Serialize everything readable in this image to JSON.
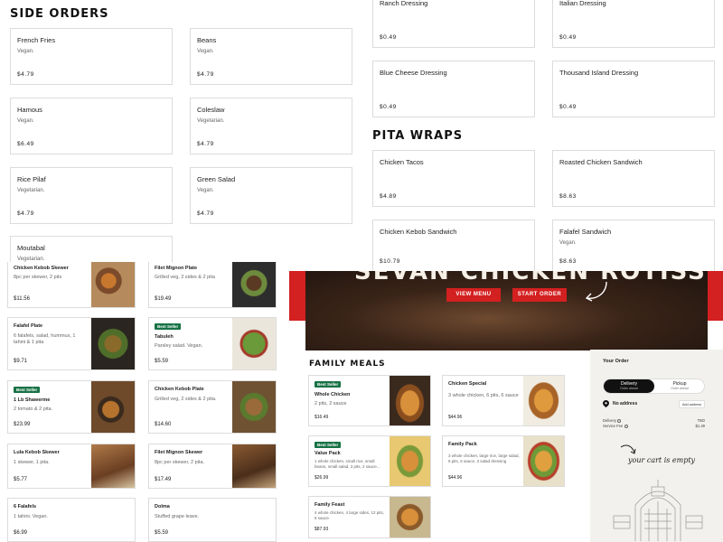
{
  "side_orders": {
    "title": "SIDE ORDERS",
    "items": [
      {
        "name": "French Fries",
        "desc": "Vegan.",
        "price": "$4.79"
      },
      {
        "name": "Beans",
        "desc": "Vegan.",
        "price": "$4.79"
      },
      {
        "name": "Hamous",
        "desc": "Vegan.",
        "price": "$6.49"
      },
      {
        "name": "Coleslaw",
        "desc": "Vegetarian.",
        "price": "$4.79"
      },
      {
        "name": "Rice Pilaf",
        "desc": "Vegetarian.",
        "price": "$4.79"
      },
      {
        "name": "Green Salad",
        "desc": "Vegan.",
        "price": "$4.79"
      },
      {
        "name": "Moutabal",
        "desc": "Vegetarian."
      }
    ]
  },
  "dressings": [
    {
      "name": "Ranch Dressing",
      "price": "$0.49"
    },
    {
      "name": "Italian Dressing",
      "price": "$0.49"
    },
    {
      "name": "Blue Cheese Dressing",
      "price": "$0.49"
    },
    {
      "name": "Thousand Island Dressing",
      "price": "$0.49"
    }
  ],
  "pita_wraps": {
    "title": "PITA WRAPS",
    "items": [
      {
        "name": "Chicken Tacos",
        "desc": "",
        "price": "$4.89"
      },
      {
        "name": "Roasted Chicken Sandwich",
        "desc": "",
        "price": "$8.63"
      },
      {
        "name": "Chicken Kebob Sandwich",
        "desc": "",
        "price": "$10.79"
      },
      {
        "name": "Falafel Sandwich",
        "desc": "Vegan.",
        "price": "$8.63"
      }
    ]
  },
  "plates": [
    {
      "name": "Chicken Kebob Skewer",
      "desc": "8pc per skewer, 2 pits",
      "price": "$11.56",
      "badge": ""
    },
    {
      "name": "Filet Mignon Plate",
      "desc": "Grilled veg, 2 sides & 2 pita",
      "price": "$19.49",
      "badge": ""
    },
    {
      "name": "Falafel Plate",
      "desc": "6 falafels, salad, hummus, 1 tahini & 1 pita",
      "price": "$9.71",
      "badge": ""
    },
    {
      "name": "Tabuleh",
      "desc": "Parsley salad. Vegan.",
      "price": "$5.59",
      "badge": "Best Seller"
    },
    {
      "name": "1 Lb Shawerme",
      "desc": "2 tomato & 2 pita.",
      "price": "$23.99",
      "badge": "Best Seller"
    },
    {
      "name": "Chicken Kebob Plate",
      "desc": "Grilled veg, 2 sides & 2 pita.",
      "price": "$14.60",
      "badge": ""
    },
    {
      "name": "Lula Kebob Skewer",
      "desc": "1 skewer, 1 pita.",
      "price": "$5.77",
      "badge": ""
    },
    {
      "name": "Filet Mignon Skewer",
      "desc": "8pc per skewer, 2 pita.",
      "price": "$17.49",
      "badge": ""
    },
    {
      "name": "6 Falafels",
      "desc": "1 tahini. Vegan.",
      "price": "$6.99",
      "badge": ""
    },
    {
      "name": "Dolma",
      "desc": "Stuffed grape leave.",
      "price": "$5.59",
      "badge": ""
    }
  ],
  "hero": {
    "title": "SEVAN CHICKEN ROTISSERIE",
    "view_menu": "VIEW MENU",
    "start_order": "START ORDER"
  },
  "family_meals": {
    "title": "FAMILY MEALS",
    "items": [
      {
        "name": "Whole Chicken",
        "desc": "2 pits, 2 sauce",
        "price": "$16.49",
        "badge": "Best Seller"
      },
      {
        "name": "Chicken Special",
        "desc": "3 whole chicken, 6 pits, 6 sauce",
        "price": "$44.96",
        "badge": ""
      },
      {
        "name": "Value Pack",
        "desc": "1 whole chicken, small rice, small beans, small salad, 3 pits, 2 sauce...",
        "price": "$26.99",
        "badge": "Best Seller"
      },
      {
        "name": "Family Pack",
        "desc": "3 whole chicken, large rice, large salad, 6 pits, 6 sauce, 3 salad dressing",
        "price": "$44.96",
        "badge": ""
      },
      {
        "name": "Family Feast",
        "desc": "4 whole chicken, 4 large sides, 12 pits, 8 sauce.",
        "price": "$87.93",
        "badge": ""
      }
    ]
  },
  "cart": {
    "title": "Your Order",
    "delivery_label": "Delivery",
    "delivery_sub": "Order ahead",
    "pickup_label": "Pickup",
    "pickup_sub": "Order ahead",
    "no_address": "No address",
    "add_address": "Add address",
    "delivery_fee_label": "Delivery",
    "delivery_fee_value": "TBD",
    "service_fee_label": "Service Fee",
    "service_fee_value": "$1.49",
    "empty_text": "your cart is empty"
  },
  "colors": {
    "accent": "#d32020",
    "badge": "#177245",
    "hero_bg": "#2a1a12"
  }
}
